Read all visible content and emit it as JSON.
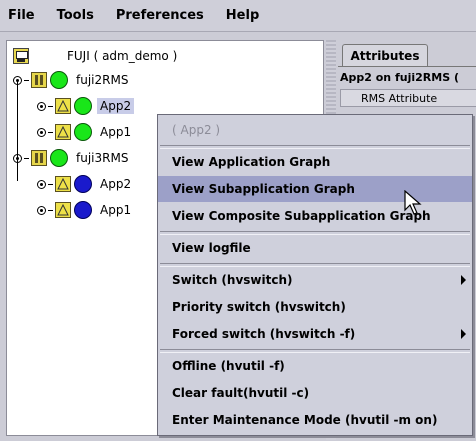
{
  "menubar": {
    "items": [
      "File",
      "Tools",
      "Preferences",
      "Help"
    ]
  },
  "tree": {
    "root": "FUJI ( adm_demo )",
    "systems": [
      {
        "label": "fuji2RMS",
        "state": "green",
        "apps": [
          {
            "label": "App2",
            "state": "green",
            "selected": true
          },
          {
            "label": "App1",
            "state": "green"
          }
        ]
      },
      {
        "label": "fuji3RMS",
        "state": "green",
        "apps": [
          {
            "label": "App2",
            "state": "blue"
          },
          {
            "label": "App1",
            "state": "blue"
          }
        ]
      }
    ]
  },
  "right_panel": {
    "tab": "Attributes",
    "title": "App2 on fuji2RMS (",
    "column": "RMS Attribute"
  },
  "context_menu": {
    "header": "( App2 )",
    "view_app_graph": "View Application Graph",
    "view_subapp_graph": "View Subapplication Graph",
    "view_composite_graph": "View Composite Subapplication Graph",
    "view_logfile": "View logfile",
    "switch": "Switch (hvswitch)",
    "priority_switch": "Priority switch (hvswitch)",
    "forced_switch": "Forced switch (hvswitch -f)",
    "offline": "Offline (hvutil -f)",
    "clear_fault": "Clear fault(hvutil -c)",
    "maintenance": "Enter Maintenance Mode (hvutil -m on)"
  },
  "colors": {
    "highlight": "#9ca0c8",
    "green_state": "#19e619",
    "blue_state": "#1a1acc"
  }
}
